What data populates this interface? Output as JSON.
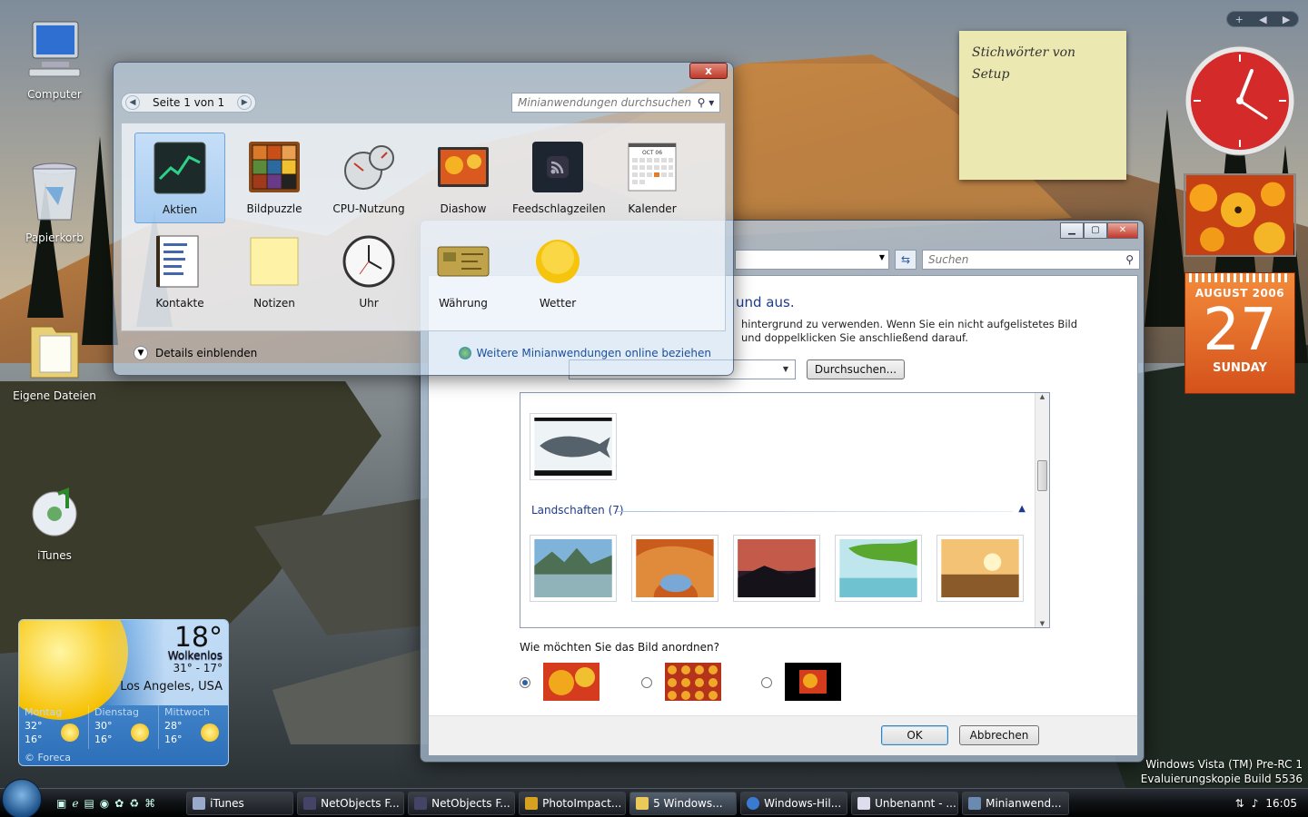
{
  "desktop": {
    "icons": [
      {
        "label": "Computer"
      },
      {
        "label": "Papierkorb"
      },
      {
        "label": "Eigene Dateien"
      },
      {
        "label": "iTunes"
      }
    ],
    "watermark_line1": "Windows Vista (TM) Pre-RC 1",
    "watermark_line2": "Evaluierungskopie Build 5536"
  },
  "gallery": {
    "close_label": "x",
    "pager_label": "Seite 1 von 1",
    "search_placeholder": "Minianwendungen durchsuchen",
    "items": [
      {
        "label": "Aktien"
      },
      {
        "label": "Bildpuzzle"
      },
      {
        "label": "CPU-Nutzung"
      },
      {
        "label": "Diashow"
      },
      {
        "label": "Feedschlagzeilen"
      },
      {
        "label": "Kalender"
      },
      {
        "label": "Kontakte"
      },
      {
        "label": "Notizen"
      },
      {
        "label": "Uhr"
      },
      {
        "label": "Währung"
      },
      {
        "label": "Wetter"
      }
    ],
    "details_label": "Details einblenden",
    "online_link": "Weitere Minianwendungen online beziehen",
    "calendar_month": "OCT 06"
  },
  "dialog": {
    "search_placeholder": "Suchen",
    "title_fragment": "und aus.",
    "text_line1": "hintergrund zu verwenden. Wenn Sie ein nicht aufgelistetes Bild",
    "text_line2": "und doppelklicken Sie anschließend darauf.",
    "browse_label": "Durchsuchen...",
    "group_label": "Landschaften (7)",
    "arrange_question": "Wie möchten Sie das Bild anordnen?",
    "ok_label": "OK",
    "cancel_label": "Abbrechen",
    "min_label": "▁",
    "max_label": "▢",
    "close_label": "✕"
  },
  "note": {
    "text_line1": "Stichwörter von",
    "text_line2": "Setup"
  },
  "calendar": {
    "month": "AUGUST 2006",
    "day": "27",
    "weekday": "SUNDAY"
  },
  "sidebar_ctrl": {
    "add": "+",
    "prev": "◀",
    "next": "▶"
  },
  "weather": {
    "temp": "18°",
    "condition": "Wolkenlos",
    "range": "31° - 17°",
    "location": "Los Angeles, USA",
    "days": [
      {
        "name": "Montag",
        "hi": "32°",
        "lo": "16°"
      },
      {
        "name": "Dienstag",
        "hi": "30°",
        "lo": "16°"
      },
      {
        "name": "Mittwoch",
        "hi": "28°",
        "lo": "16°"
      }
    ],
    "brand": "© Foreca"
  },
  "taskbar": {
    "buttons": [
      {
        "label": "iTunes"
      },
      {
        "label": "NetObjects F..."
      },
      {
        "label": "NetObjects F..."
      },
      {
        "label": "PhotoImpact..."
      },
      {
        "label": "5 Windows..."
      },
      {
        "label": "Windows-Hil..."
      },
      {
        "label": "Unbenannt - ..."
      },
      {
        "label": "Minianwend..."
      }
    ],
    "clock": "16:05"
  },
  "colors": {
    "accent": "#1e3a8a",
    "calendar_orange": "#e0621f",
    "clock_red": "#d42a2a"
  }
}
